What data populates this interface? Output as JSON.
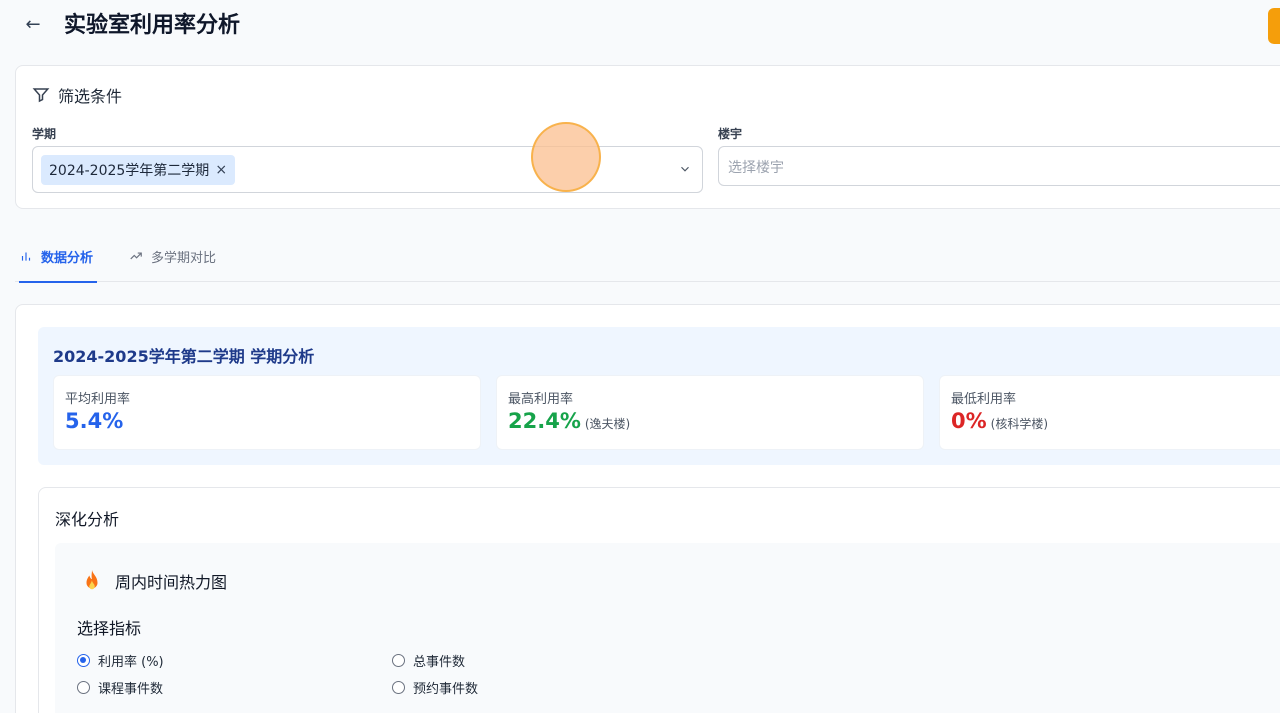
{
  "header": {
    "title": "实验室利用率分析"
  },
  "filters": {
    "title": "筛选条件",
    "semester": {
      "label": "学期",
      "selected_tags": [
        "2024-2025学年第二学期"
      ],
      "remove_glyph": "×"
    },
    "building": {
      "label": "楼宇",
      "placeholder": "选择楼宇"
    }
  },
  "tabs": [
    {
      "label": "数据分析",
      "active": true,
      "icon": "bar-chart-icon"
    },
    {
      "label": "多学期对比",
      "active": false,
      "icon": "trend-icon"
    }
  ],
  "semester_analysis": {
    "title": "2024-2025学年第二学期 学期分析",
    "stats": [
      {
        "label": "平均利用率",
        "value": "5.4%",
        "note": "",
        "color": "#2563eb"
      },
      {
        "label": "最高利用率",
        "value": "22.4%",
        "note": "(逸夫楼)",
        "color": "#16a34a"
      },
      {
        "label": "最低利用率",
        "value": "0%",
        "note": "(核科学楼)",
        "color": "#dc2626"
      }
    ]
  },
  "deep_analysis": {
    "title": "深化分析",
    "heatmap": {
      "title": "周内时间热力图",
      "icon": "flame-icon",
      "metric_label": "选择指标",
      "options": [
        {
          "label": "利用率 (%)",
          "checked": true
        },
        {
          "label": "总事件数",
          "checked": false
        },
        {
          "label": "课程事件数",
          "checked": false
        },
        {
          "label": "预约事件数",
          "checked": false
        }
      ]
    }
  },
  "colors": {
    "accent": "#2563eb",
    "high": "#16a34a",
    "low": "#dc2626"
  }
}
